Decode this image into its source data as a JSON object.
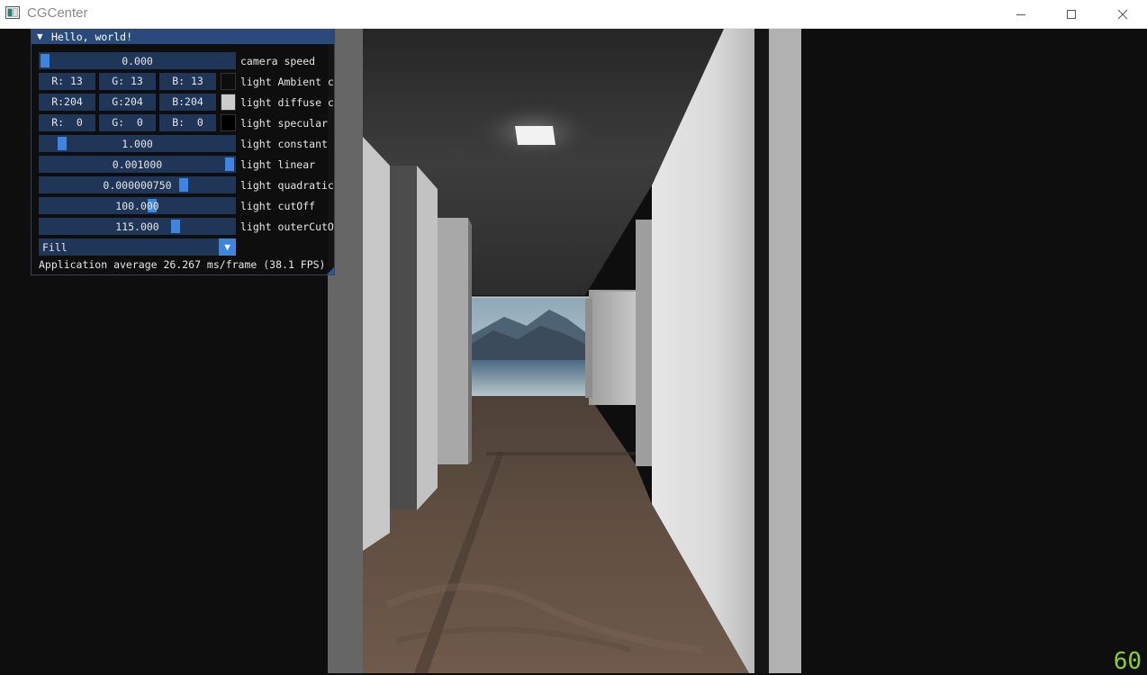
{
  "window": {
    "title": "CGCenter",
    "minimize_icon": "minimize-icon",
    "maximize_icon": "maximize-icon",
    "close_icon": "close-icon"
  },
  "panel": {
    "title": "Hello, world!",
    "collapse_icon": "triangle-down-icon",
    "camera_speed": {
      "value": "0.000",
      "label": "camera speed",
      "fraction": 0.0
    },
    "light_ambient": {
      "r": "R: 13",
      "g": "G: 13",
      "b": "B: 13",
      "label": "light Ambient c",
      "swatch": "#0d0d0d"
    },
    "light_diffuse": {
      "r": "R:204",
      "g": "G:204",
      "b": "B:204",
      "label": "light diffuse c",
      "swatch": "#cccccc"
    },
    "light_specular": {
      "r": "R:  0",
      "g": "G:  0",
      "b": "B:  0",
      "label": "light specular",
      "swatch": "#000000"
    },
    "light_constant": {
      "value": "1.000",
      "label": "light constant",
      "fraction": 0.11
    },
    "light_linear": {
      "value": "0.001000",
      "label": "light linear",
      "fraction": 1.0
    },
    "light_quadratic": {
      "value": "0.000000750",
      "label": "light quadratic",
      "fraction": 0.75
    },
    "light_cutoff": {
      "value": "100.000",
      "label": "light cutOff",
      "fraction": 0.58
    },
    "light_outercutoff": {
      "value": "115.000",
      "label": "light outerCutO",
      "fraction": 0.7
    },
    "polygon_mode": {
      "value": "Fill",
      "arrow_icon": "triangle-down-icon"
    },
    "fps_text": "Application average 26.267 ms/frame (38.1 FPS)"
  },
  "fps_counter": "60",
  "colors": {
    "title_bar": "#294a7a",
    "frame_bg": "#1f3659",
    "slider_grab": "#3d85e0",
    "fps_counter": "#8ad12a"
  }
}
